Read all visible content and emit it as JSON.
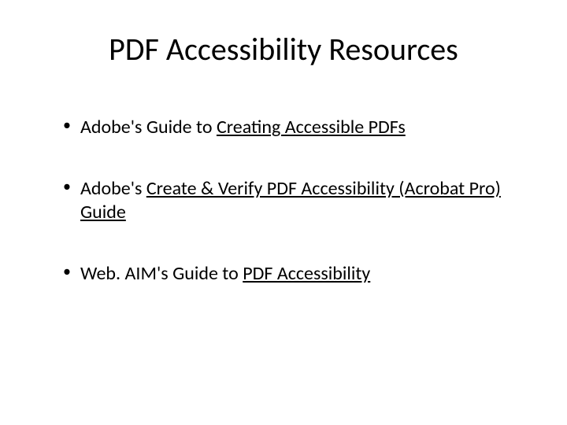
{
  "title": "PDF Accessibility Resources",
  "items": [
    {
      "prefix": "Adobe's Guide to ",
      "link": "Creating Accessible PDFs",
      "suffix": ""
    },
    {
      "prefix": "Adobe's ",
      "link": "Create & Verify PDF Accessibility (Acrobat Pro) Guide",
      "suffix": ""
    },
    {
      "prefix": "Web. AIM's Guide to ",
      "link": "PDF Accessibility",
      "suffix": ""
    }
  ]
}
